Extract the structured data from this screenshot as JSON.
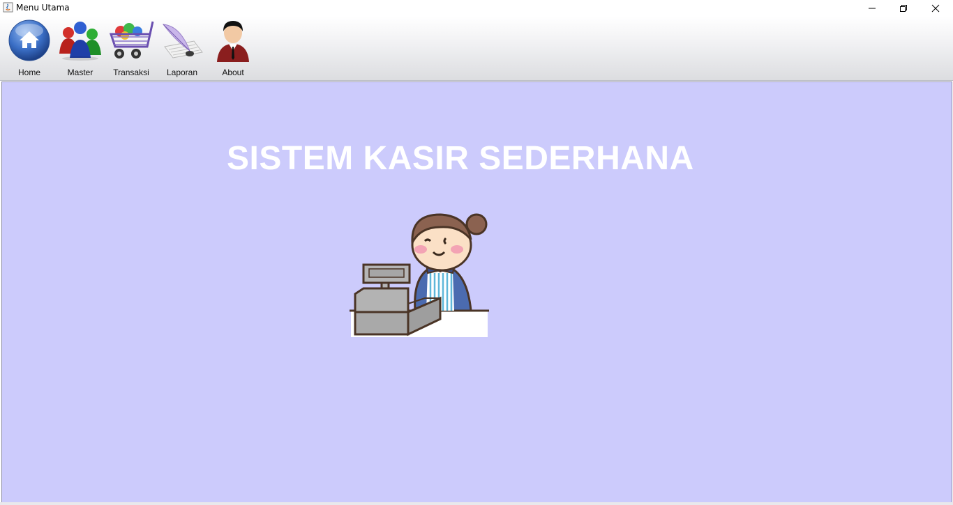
{
  "window": {
    "title": "Menu Utama",
    "controls": [
      "minimize",
      "restore",
      "close"
    ]
  },
  "toolbar": {
    "items": [
      {
        "label": "Home",
        "icon": "home-icon"
      },
      {
        "label": "Master",
        "icon": "users-icon"
      },
      {
        "label": "Transaksi",
        "icon": "shopping-cart-icon"
      },
      {
        "label": "Laporan",
        "icon": "quill-document-icon"
      },
      {
        "label": "About",
        "icon": "person-icon"
      }
    ]
  },
  "main": {
    "heading": "SISTEM KASIR SEDERHANA",
    "background": "#cccbfc",
    "illustration": "cashier-illustration"
  }
}
